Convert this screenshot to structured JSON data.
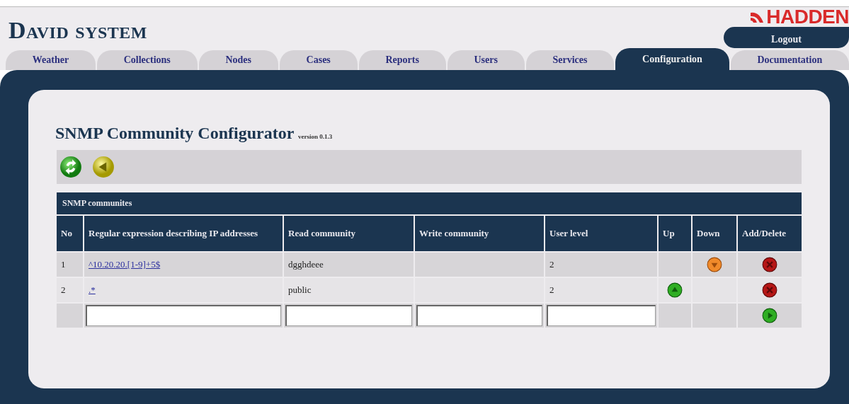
{
  "header": {
    "title": "David system",
    "logo": "HADDEN",
    "logout": "Logout"
  },
  "tabs": [
    {
      "label": "Weather",
      "selected": false
    },
    {
      "label": "Collections",
      "selected": false
    },
    {
      "label": "Nodes",
      "selected": false
    },
    {
      "label": "Cases",
      "selected": false
    },
    {
      "label": "Reports",
      "selected": false
    },
    {
      "label": "Users",
      "selected": false
    },
    {
      "label": "Services",
      "selected": false
    },
    {
      "label": "Configuration",
      "selected": true
    },
    {
      "label": "Documentation",
      "selected": false
    }
  ],
  "page": {
    "title": "SNMP Community Configurator",
    "version": "version 0.1.3"
  },
  "table": {
    "caption": "SNMP communites",
    "columns": [
      "No",
      "Regular expression describing IP addresses",
      "Read community",
      "Write community",
      "User level",
      "Up",
      "Down",
      "Add/Delete"
    ],
    "rows": [
      {
        "no": "1",
        "regex": "^10.20.20.[1-9]+5$",
        "read": "dgghdeee",
        "user_level": "2",
        "can_up": false,
        "can_down": true
      },
      {
        "no": "2",
        "regex": ".*",
        "read": "public",
        "user_level": "2",
        "can_up": true,
        "can_down": false
      }
    ]
  }
}
